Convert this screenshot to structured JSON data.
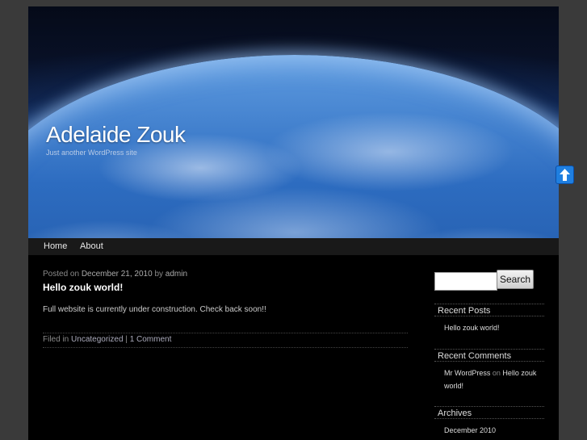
{
  "site": {
    "title": "Adelaide Zouk",
    "description": "Just another WordPress site"
  },
  "nav": {
    "items": [
      {
        "label": "Home"
      },
      {
        "label": "About"
      }
    ]
  },
  "post": {
    "posted_on_label": "Posted on",
    "date": "December 21, 2010",
    "by_label": "by",
    "author": "admin",
    "title": "Hello zouk world!",
    "body": "Full website is currently under construction.  Check back soon!!",
    "filed_in_label": "Filed in",
    "category": "Uncategorized",
    "separator": "|",
    "comments": "1 Comment"
  },
  "sidebar": {
    "search": {
      "value": "",
      "button_label": "Search"
    },
    "recent_posts": {
      "title": "Recent Posts",
      "items": [
        "Hello zouk world!"
      ]
    },
    "recent_comments": {
      "title": "Recent Comments",
      "author": "Mr WordPress",
      "on_label": "on",
      "post_part1": "Hello zouk",
      "post_part2": "world!"
    },
    "archives": {
      "title": "Archives",
      "items": [
        "December 2010"
      ]
    }
  },
  "icons": {
    "back_to_top": "arrow-up-icon"
  },
  "colors": {
    "page_bg": "#3a3a3a",
    "content_bg": "#000000",
    "nav_bg": "#191919",
    "accent_blue": "#1f7fe0"
  }
}
